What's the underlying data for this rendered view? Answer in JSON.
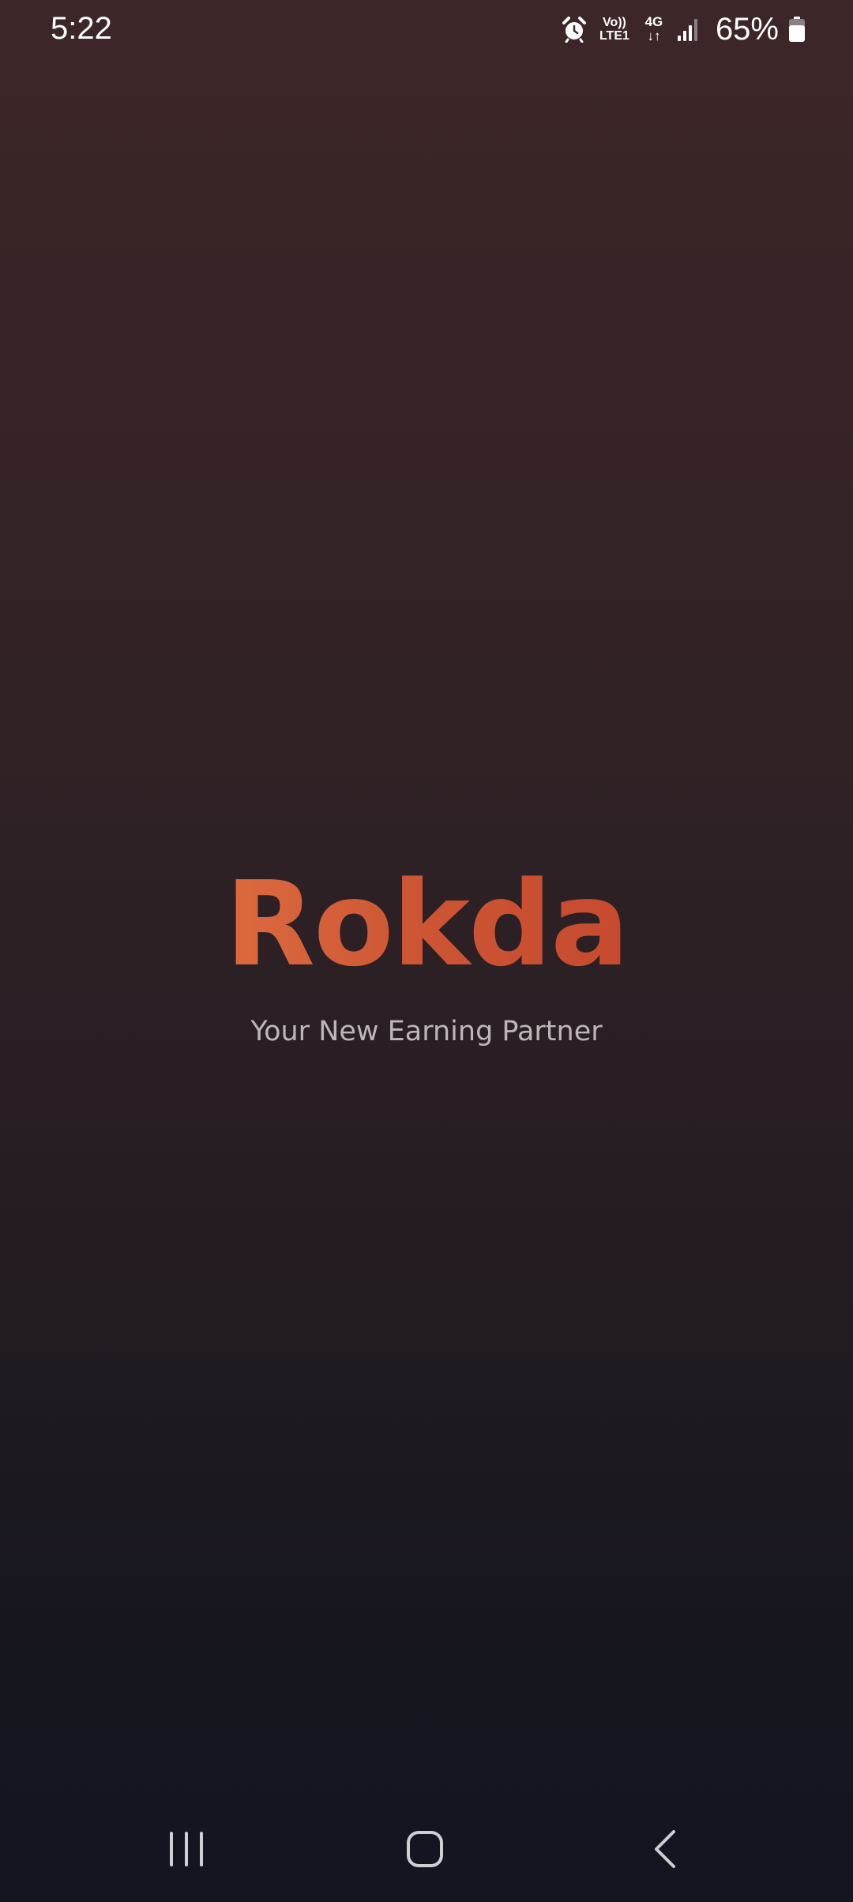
{
  "status_bar": {
    "time": "5:22",
    "volte_top": "Vo))",
    "volte_bottom": "LTE1",
    "network_type": "4G",
    "network_arrows": "↓↑",
    "battery_percent": "65%",
    "icons": [
      "alarm-icon",
      "volte-icon",
      "data-activity-icon",
      "signal-icon",
      "battery-icon"
    ]
  },
  "splash": {
    "logo_text": "Rokda",
    "tagline": "Your New Earning Partner"
  },
  "nav_bar": {
    "buttons": [
      "recent-apps-icon",
      "home-icon",
      "back-icon"
    ]
  },
  "colors": {
    "brand_orange": "#d4623a",
    "background_top": "#3d2627",
    "background_bottom": "#141520",
    "tagline_gray": "#bdb6b8"
  }
}
